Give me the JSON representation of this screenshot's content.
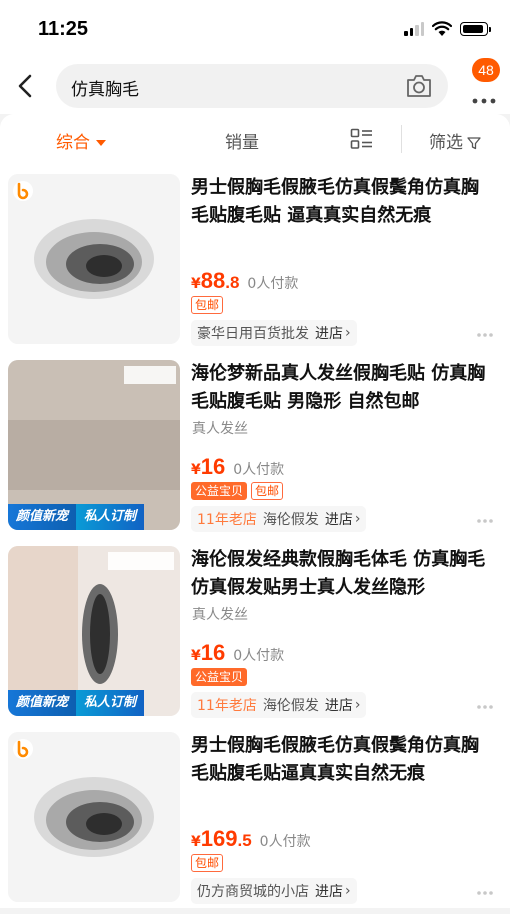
{
  "status_bar": {
    "time": "11:25"
  },
  "search": {
    "query": "仿真胸毛",
    "badge_count": "48"
  },
  "sort_bar": {
    "tabs": [
      "综合",
      "销量"
    ],
    "filter_label": "筛选"
  },
  "products": [
    {
      "title": "男士假胸毛假腋毛仿真假鬓角仿真胸毛贴腹毛贴 逼真真实自然无痕",
      "subtitle": "",
      "price_symbol": "¥",
      "price_int": "88",
      "price_dec": ".8",
      "sales": "0人付款",
      "tags": [
        "包邮"
      ],
      "store_age": "",
      "store_name": "豪华日用百货批发",
      "enter_label": "进店"
    },
    {
      "title": "海伦梦新品真人发丝假胸毛贴 仿真胸毛贴腹毛贴 男隐形 自然包邮",
      "subtitle": "真人发丝",
      "price_symbol": "¥",
      "price_int": "16",
      "price_dec": "",
      "sales": "0人付款",
      "tags": [
        "公益宝贝",
        "包邮"
      ],
      "store_age": "11年老店",
      "store_name": "海伦假发",
      "enter_label": "进店",
      "image_tags": [
        "颜值新宠",
        "私人订制"
      ]
    },
    {
      "title": "海伦假发经典款假胸毛体毛 仿真胸毛仿真假发贴男士真人发丝隐形",
      "subtitle": "真人发丝",
      "price_symbol": "¥",
      "price_int": "16",
      "price_dec": "",
      "sales": "0人付款",
      "tags": [
        "公益宝贝"
      ],
      "store_age": "11年老店",
      "store_name": "海伦假发",
      "enter_label": "进店",
      "image_tags": [
        "颜值新宠",
        "私人订制"
      ]
    },
    {
      "title": "男士假胸毛假腋毛仿真假鬓角仿真胸毛贴腹毛贴逼真真实自然无痕",
      "subtitle": "",
      "price_symbol": "¥",
      "price_int": "169",
      "price_dec": ".5",
      "sales": "0人付款",
      "tags": [
        "包邮"
      ],
      "store_age": "",
      "store_name": "仍方商贸城的小店",
      "enter_label": "进店"
    }
  ],
  "icons": {
    "back": "chevron-left-icon",
    "camera": "camera-icon",
    "more": "more-dots-icon",
    "layout": "list-layout-icon",
    "filter": "funnel-icon"
  },
  "colors": {
    "accent": "#ff5a00",
    "price": "#ff3b00"
  }
}
